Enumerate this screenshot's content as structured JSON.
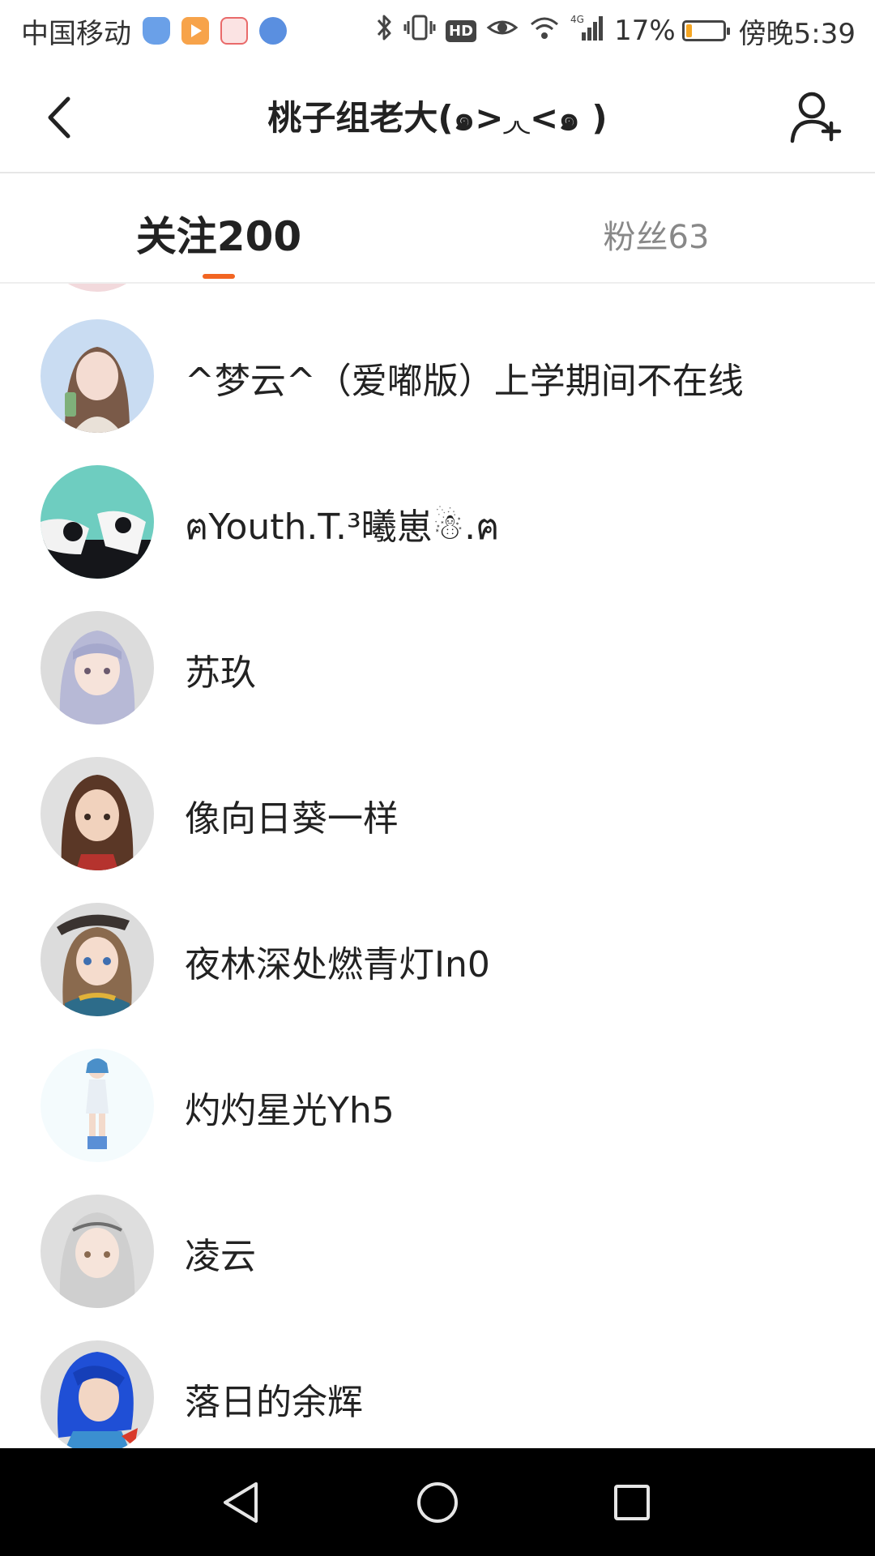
{
  "status_bar": {
    "carrier": "中国移动",
    "network": "4G",
    "hd": "HD",
    "battery_percent": "17%",
    "battery_level": 0.17,
    "time": "傍晚5:39",
    "icons": [
      "shield-app-icon",
      "video-app-icon",
      "baidu-app-icon",
      "browser-app-icon",
      "bluetooth-icon",
      "vibrate-icon",
      "hd-icon",
      "eye-icon",
      "wifi-icon",
      "signal-icon",
      "battery-icon"
    ]
  },
  "header": {
    "title": "桃子组老大(๑>◞◟<๑ )",
    "back_icon": "chevron-left-icon",
    "add_icon": "add-friend-icon"
  },
  "tabs": [
    {
      "label": "关注200",
      "active": true
    },
    {
      "label": "粉丝63",
      "active": false
    }
  ],
  "colors": {
    "accent": "#f26522",
    "text_primary": "#222222",
    "text_secondary": "#888888",
    "divider": "#eeeeee"
  },
  "users": [
    {
      "name": "^梦云^（爱嘟版）上学期间不在线",
      "avatar": "girl-portrait-avatar"
    },
    {
      "name": "ฅYouth.T.³曦崽☃.ฅ",
      "avatar": "teal-illustration-avatar"
    },
    {
      "name": "苏玖",
      "avatar": "silver-hair-anime-avatar"
    },
    {
      "name": "像向日葵一样",
      "avatar": "brown-hair-anime-avatar"
    },
    {
      "name": "夜林深处燃青灯In0",
      "avatar": "beret-anime-avatar"
    },
    {
      "name": "灼灼星光Yh5",
      "avatar": "full-body-anime-avatar"
    },
    {
      "name": "凌云",
      "avatar": "white-hair-anime-avatar"
    },
    {
      "name": "落日的余辉",
      "avatar": "blue-hair-anime-avatar"
    }
  ],
  "nav_bar": {
    "icons": [
      "nav-back-icon",
      "nav-home-icon",
      "nav-recent-icon"
    ]
  }
}
